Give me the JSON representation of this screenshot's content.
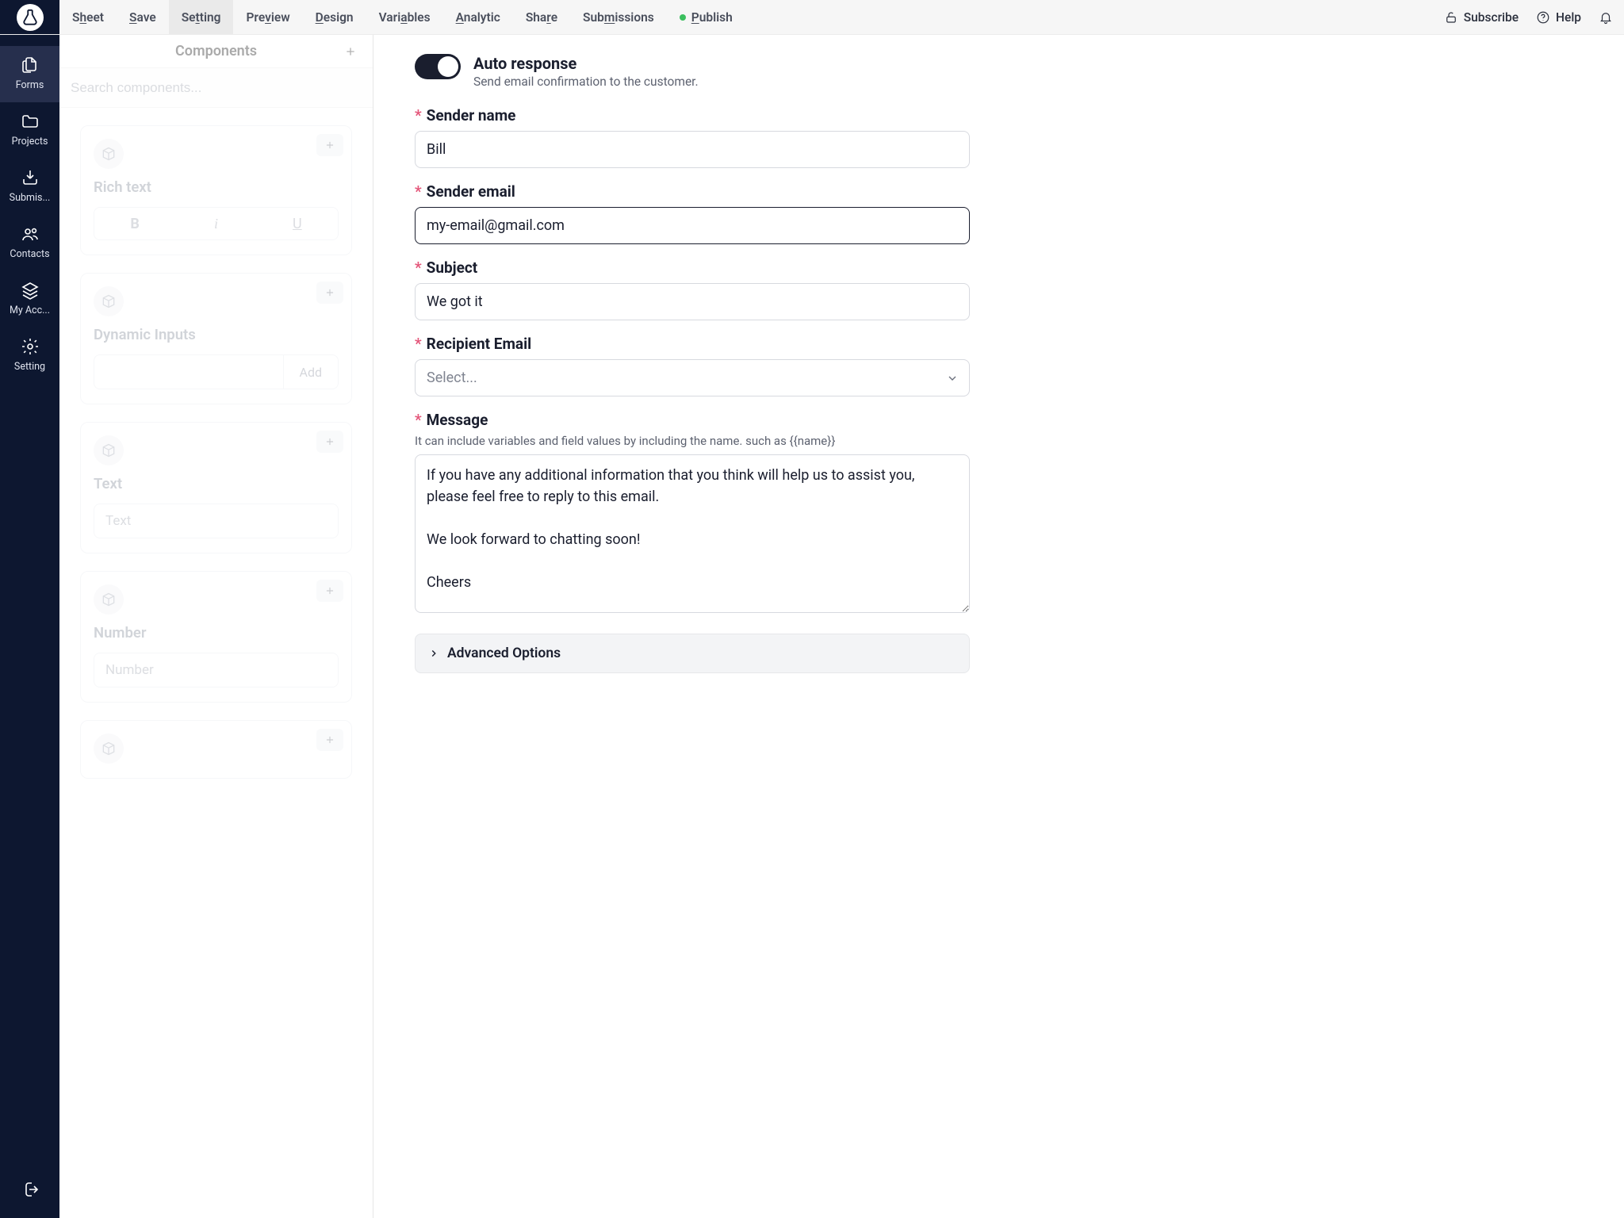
{
  "topbar": {
    "menu": [
      {
        "pre": "S",
        "ul": "h",
        "post": "eet"
      },
      {
        "pre": "",
        "ul": "S",
        "post": "ave"
      },
      {
        "pre": "Se",
        "ul": "t",
        "post": "ting"
      },
      {
        "pre": "Pre",
        "ul": "v",
        "post": "iew"
      },
      {
        "pre": "",
        "ul": "D",
        "post": "esign"
      },
      {
        "pre": "Vari",
        "ul": "a",
        "post": "bles"
      },
      {
        "pre": "",
        "ul": "A",
        "post": "nalytic"
      },
      {
        "pre": "Sha",
        "ul": "r",
        "post": "e"
      },
      {
        "pre": "Sub",
        "ul": "m",
        "post": "issions"
      },
      {
        "pre": "",
        "ul": "P",
        "post": "ublish"
      }
    ],
    "subscribe": "Subscribe",
    "help": "Help"
  },
  "rail": {
    "forms": "Forms",
    "projects": "Projects",
    "submissions": "Submis...",
    "contacts": "Contacts",
    "account": "My Acc...",
    "setting": "Setting"
  },
  "components": {
    "title": "Components",
    "search_placeholder": "Search components...",
    "rich_text": "Rich text",
    "btn_b": "B",
    "btn_i": "i",
    "btn_u": "U",
    "dynamic_inputs": "Dynamic Inputs",
    "add": "Add",
    "text": "Text",
    "text_placeholder": "Text",
    "number": "Number",
    "number_placeholder": "Number"
  },
  "settings": {
    "auto_response_title": "Auto response",
    "auto_response_desc": "Send email confirmation to the customer.",
    "sender_name_label": "Sender name",
    "sender_name_value": "Bill",
    "sender_email_label": "Sender email",
    "sender_email_value": "my-email@gmail.com",
    "subject_label": "Subject",
    "subject_value": "We got it",
    "recipient_label": "Recipient Email",
    "recipient_placeholder": "Select...",
    "message_label": "Message",
    "message_help": "It can include variables and field values by including the name. such as {{name}}",
    "message_value": "If you have any additional information that you think will help us to assist you,\nplease feel free to reply to this email.\n\nWe look forward to chatting soon!\n\nCheers",
    "advanced": "Advanced Options"
  }
}
